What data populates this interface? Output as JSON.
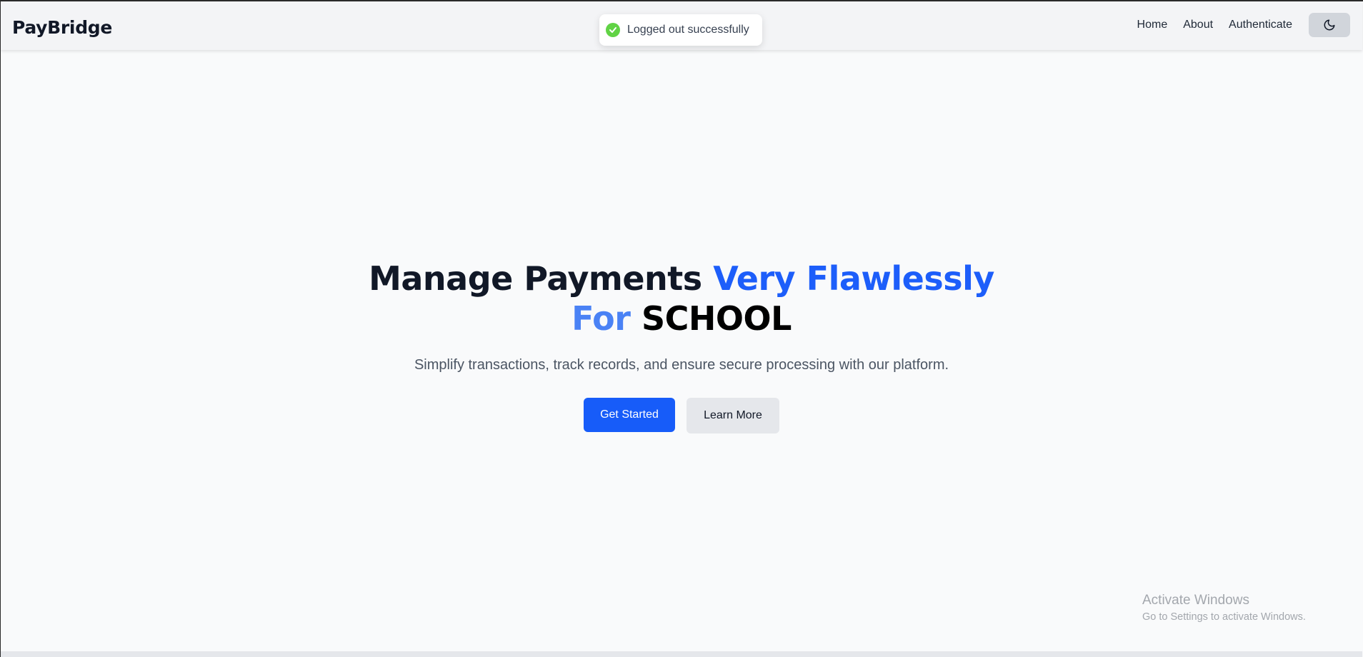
{
  "navbar": {
    "brand": "PayBridge",
    "links": [
      "Home",
      "About",
      "Authenticate"
    ],
    "theme_toggle_icon": "moon-icon"
  },
  "toast": {
    "message": "Logged out successfully",
    "icon": "check-circle-icon",
    "color": "#61d345"
  },
  "hero": {
    "headline_part1": "Manage Payments",
    "headline_part2": "Very Flawlessly",
    "headline_part3": "For",
    "headline_part4": "SCHOOL",
    "subtitle": "Simplify transactions, track records, and ensure secure processing with our platform.",
    "primary_button": "Get Started",
    "secondary_button": "Learn More"
  },
  "watermark": {
    "title": "Activate Windows",
    "subtitle": "Go to Settings to activate Windows."
  },
  "colors": {
    "accent": "#1d5efa",
    "accent_light": "#4a82f5",
    "primary_button": "#175cf9",
    "background": "#f9fafb"
  }
}
